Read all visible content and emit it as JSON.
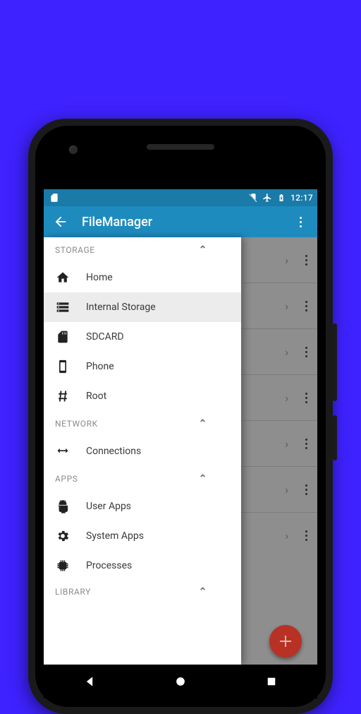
{
  "statusbar": {
    "time": "12:17"
  },
  "appbar": {
    "title": "FileManager"
  },
  "drawer": {
    "sections": [
      {
        "label": "STORAGE",
        "items": [
          {
            "icon": "home",
            "label": "Home",
            "selected": false
          },
          {
            "icon": "storage",
            "label": "Internal Storage",
            "selected": true
          },
          {
            "icon": "sdcard",
            "label": "SDCARD",
            "selected": false
          },
          {
            "icon": "phone",
            "label": "Phone",
            "selected": false
          },
          {
            "icon": "hash",
            "label": "Root",
            "selected": false
          }
        ]
      },
      {
        "label": "NETWORK",
        "items": [
          {
            "icon": "connections",
            "label": "Connections",
            "selected": false
          }
        ]
      },
      {
        "label": "APPS",
        "items": [
          {
            "icon": "android",
            "label": "User Apps",
            "selected": false
          },
          {
            "icon": "gear",
            "label": "System Apps",
            "selected": false
          },
          {
            "icon": "chip",
            "label": "Processes",
            "selected": false
          }
        ]
      },
      {
        "label": "LIBRARY",
        "items": []
      }
    ]
  }
}
